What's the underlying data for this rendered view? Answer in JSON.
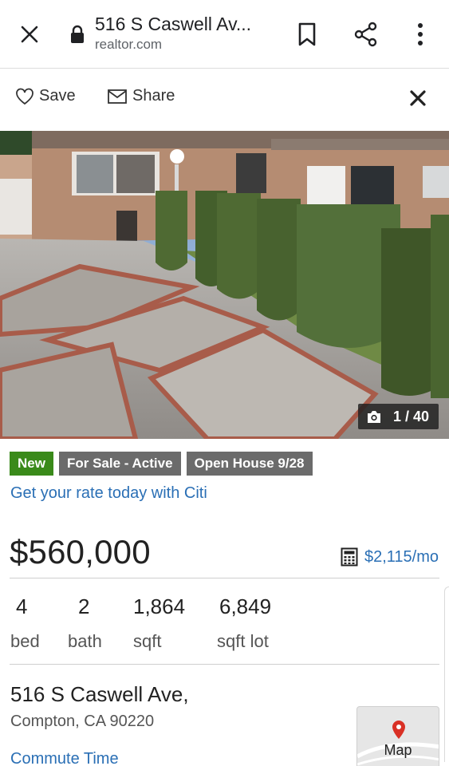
{
  "browser": {
    "title": "516 S Caswell Av...",
    "url": "realtor.com",
    "icons": [
      "close-icon",
      "lock-icon",
      "bookmark-icon",
      "share-icon",
      "more-vert-icon"
    ]
  },
  "toolbar": {
    "save_label": "Save",
    "share_label": "Share",
    "icons": [
      "heart-icon",
      "mail-icon",
      "close-icon"
    ]
  },
  "photo": {
    "counter": "1 / 40",
    "icon": "camera-icon"
  },
  "badges": [
    {
      "label": "New",
      "color": "#3a8a1a"
    },
    {
      "label": "For Sale - Active",
      "color": "#6b6b6b"
    },
    {
      "label": "Open House 9/28",
      "color": "#6b6b6b"
    }
  ],
  "promo": {
    "citi_link": "Get your rate today with Citi"
  },
  "listing": {
    "price": "$560,000",
    "monthly": "$2,115/mo",
    "stats": [
      {
        "value": "4",
        "label": "bed"
      },
      {
        "value": "2",
        "label": "bath"
      },
      {
        "value": "1,864",
        "label": "sqft"
      },
      {
        "value": "6,849",
        "label": "sqft lot"
      }
    ],
    "address": "516 S Caswell Ave,",
    "city": "Compton, CA 90220",
    "commute_link": "Commute Time",
    "map_label": "Map"
  },
  "colors": {
    "link": "#2a6fb5",
    "new_badge": "#3a8a1a",
    "status_badge": "#6b6b6b",
    "map_pin": "#d93025"
  }
}
